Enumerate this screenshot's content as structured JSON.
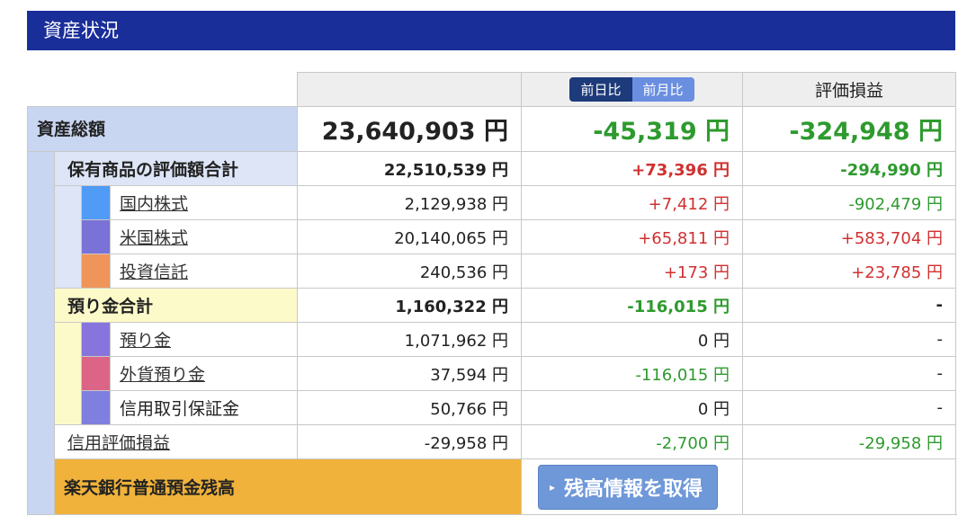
{
  "header": {
    "title": "資産状況"
  },
  "columns": {
    "toggle_day": "前日比",
    "toggle_month": "前月比",
    "valuation": "評価損益"
  },
  "total": {
    "label": "資産総額",
    "value": "23,640,903 円",
    "change": "-45,319 円",
    "valuation": "-324,948 円"
  },
  "holdings": {
    "label": "保有商品の評価額合計",
    "value": "22,510,539 円",
    "change": "+73,396 円",
    "valuation": "-294,990 円"
  },
  "holdings_items": [
    {
      "label": "国内株式",
      "value": "2,129,938 円",
      "change": "+7,412 円",
      "valuation": "-902,479 円"
    },
    {
      "label": "米国株式",
      "value": "20,140,065 円",
      "change": "+65,811 円",
      "valuation": "+583,704 円"
    },
    {
      "label": "投資信託",
      "value": "240,536 円",
      "change": "+173 円",
      "valuation": "+23,785 円"
    }
  ],
  "deposits": {
    "label": "預り金合計",
    "value": "1,160,322 円",
    "change": "-116,015 円",
    "valuation": "-"
  },
  "deposit_items": [
    {
      "label": "預り金",
      "value": "1,071,962 円",
      "change": "0 円",
      "valuation": "-"
    },
    {
      "label": "外貨預り金",
      "value": "37,594 円",
      "change": "-116,015 円",
      "valuation": "-"
    },
    {
      "label": "信用取引保証金",
      "value": "50,766 円",
      "change": "0 円",
      "valuation": "-"
    }
  ],
  "margin": {
    "label": "信用評価損益",
    "value": "-29,958 円",
    "change": "-2,700 円",
    "valuation": "-29,958 円"
  },
  "bank": {
    "label": "楽天銀行普通預金残高",
    "button": "残高情報を取得"
  },
  "colors": {
    "header_bg": "#1a2e9a",
    "positive": "#d03030",
    "negative": "#2e9a2e",
    "domestic_stock": "#4f9bf5",
    "us_stock": "#7a72d6",
    "fund": "#f0955a",
    "deposit": "#8774dd",
    "fx_deposit": "#dc6486",
    "margin_deposit": "#7f7fdf"
  }
}
